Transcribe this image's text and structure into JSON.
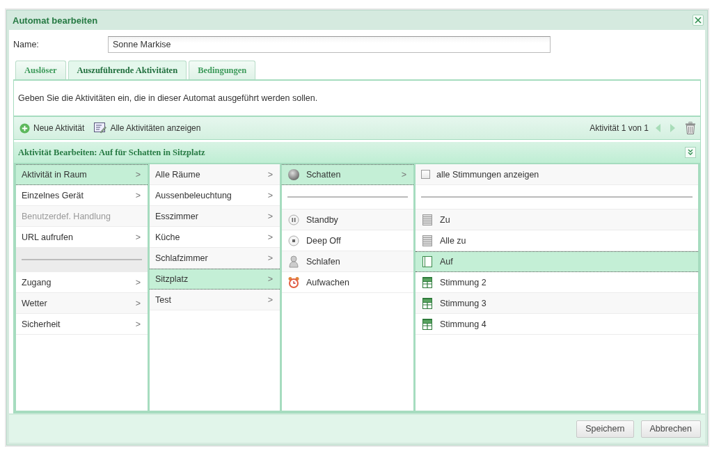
{
  "window": {
    "title": "Automat bearbeiten"
  },
  "name_field": {
    "label": "Name:",
    "value": "Sonne Markise"
  },
  "tabs": [
    {
      "label": "Auslöser",
      "selected": false
    },
    {
      "label": "Auszuführende Aktivitäten",
      "selected": true
    },
    {
      "label": "Bedingungen",
      "selected": false
    }
  ],
  "description": "Geben Sie die Aktivitäten ein, die in dieser Automat ausgeführt werden sollen.",
  "toolbar": {
    "buttons": [
      {
        "label": "Neue Aktivität",
        "kind": "add"
      },
      {
        "label": "Alle Aktivitäten anzeigen",
        "kind": "list"
      }
    ],
    "pager": "Aktivität 1 von 1"
  },
  "editor": {
    "title": "Aktivität Bearbeiten: Auf für Schatten in Sitzplatz",
    "columns": [
      {
        "items": [
          {
            "kind": "item",
            "label": "Aktivität in Raum",
            "arrow": ">",
            "selected": true,
            "disabled": false
          },
          {
            "kind": "item",
            "label": "Einzelnes Gerät",
            "arrow": ">",
            "selected": false,
            "disabled": false
          },
          {
            "kind": "item",
            "label": "Benutzerdef. Handlung",
            "selected": false,
            "disabled": true
          },
          {
            "kind": "item",
            "label": "URL aufrufen",
            "arrow": ">",
            "selected": false,
            "disabled": false
          },
          {
            "kind": "separator"
          },
          {
            "kind": "item",
            "label": "Zugang",
            "arrow": ">",
            "selected": false,
            "disabled": false
          },
          {
            "kind": "item",
            "label": "Wetter",
            "arrow": ">",
            "selected": false,
            "disabled": false
          },
          {
            "kind": "item",
            "label": "Sicherheit",
            "arrow": ">",
            "selected": false,
            "disabled": false
          }
        ]
      },
      {
        "items": [
          {
            "kind": "item",
            "label": "Alle Räume",
            "arrow": ">",
            "selected": false,
            "disabled": false
          },
          {
            "kind": "item",
            "label": "Aussenbeleuchtung",
            "arrow": ">",
            "selected": false,
            "disabled": false
          },
          {
            "kind": "item",
            "label": "Esszimmer",
            "arrow": ">",
            "selected": false,
            "disabled": false
          },
          {
            "kind": "item",
            "label": "Küche",
            "arrow": ">",
            "selected": false,
            "disabled": false
          },
          {
            "kind": "item",
            "label": "Schlafzimmer",
            "arrow": ">",
            "selected": false,
            "disabled": false
          },
          {
            "kind": "item",
            "label": "Sitzplatz",
            "arrow": ">",
            "selected": true,
            "disabled": false
          },
          {
            "kind": "item",
            "label": "Test",
            "arrow": ">",
            "selected": false,
            "disabled": false
          }
        ]
      },
      {
        "items": [
          {
            "kind": "sphere",
            "label": "Schatten",
            "arrow": ">",
            "selected": true,
            "disabled": false
          },
          {
            "kind": "separator"
          },
          {
            "kind": "pause",
            "label": "Standby",
            "selected": false,
            "disabled": false
          },
          {
            "kind": "stop",
            "label": "Deep Off",
            "selected": false,
            "disabled": false
          },
          {
            "kind": "person",
            "label": "Schlafen",
            "selected": false,
            "disabled": false
          },
          {
            "kind": "clock",
            "label": "Aufwachen",
            "selected": false,
            "disabled": false
          }
        ]
      },
      {
        "items": [
          {
            "kind": "checkbox",
            "label": "alle Stimmungen anzeigen",
            "checked": false
          },
          {
            "kind": "separator"
          },
          {
            "kind": "closed",
            "label": "Zu",
            "selected": false,
            "disabled": false
          },
          {
            "kind": "closed",
            "label": "Alle zu",
            "selected": false,
            "disabled": false
          },
          {
            "kind": "open",
            "label": "Auf",
            "selected": true,
            "disabled": false
          },
          {
            "kind": "scene",
            "label": "Stimmung 2",
            "selected": false,
            "disabled": false
          },
          {
            "kind": "scene",
            "label": "Stimmung 3",
            "selected": false,
            "disabled": false
          },
          {
            "kind": "scene",
            "label": "Stimmung 4",
            "selected": false,
            "disabled": false
          }
        ]
      }
    ]
  },
  "buttons": [
    "Speichern",
    "Abbrechen"
  ]
}
